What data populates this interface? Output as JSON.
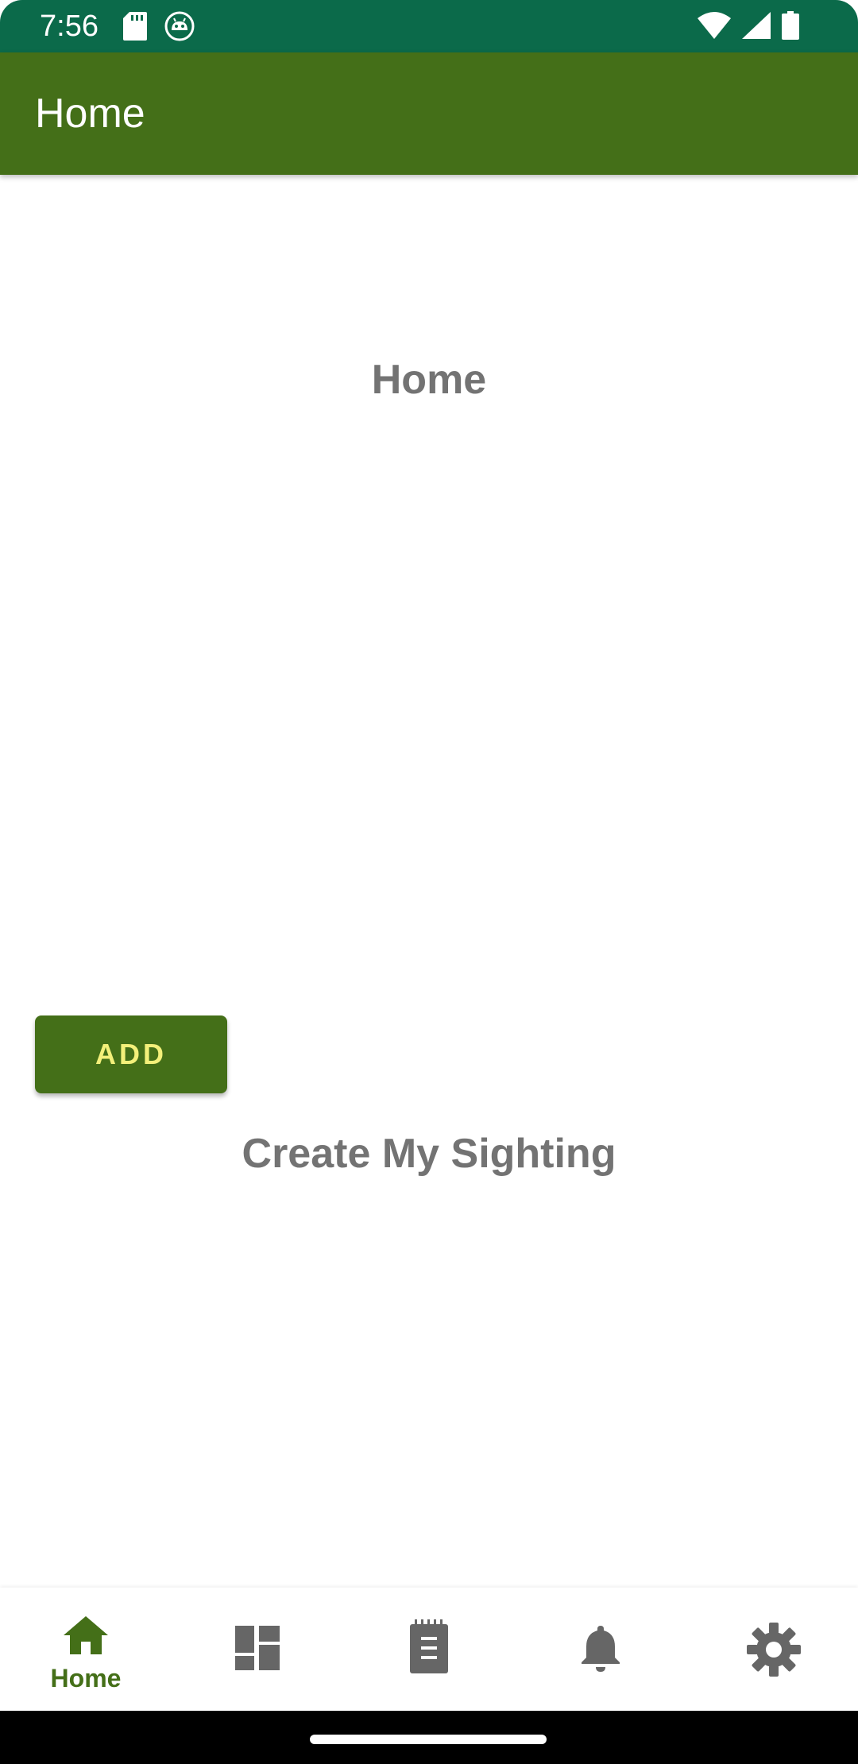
{
  "status_bar": {
    "time": "7:56",
    "left_icons": [
      "sd-card-icon",
      "android-debug-icon"
    ],
    "right_icons": [
      "wifi-icon",
      "cell-signal-icon",
      "battery-icon"
    ],
    "color": "#0b6a4a"
  },
  "app_bar": {
    "title": "Home",
    "color": "#446f18"
  },
  "content": {
    "title": "Home",
    "add_button_label": "ADD",
    "caption": "Create My Sighting"
  },
  "bottom_nav": {
    "items": [
      {
        "icon": "home-icon",
        "label": "Home",
        "active": true
      },
      {
        "icon": "dashboard-icon",
        "label": "",
        "active": false
      },
      {
        "icon": "notepad-icon",
        "label": "",
        "active": false
      },
      {
        "icon": "bell-icon",
        "label": "",
        "active": false
      },
      {
        "icon": "gear-icon",
        "label": "",
        "active": false
      }
    ],
    "active_color": "#446f18",
    "inactive_color": "#666666"
  },
  "colors": {
    "accent": "#446f18",
    "button_text": "#f3f07a",
    "text_gray": "#737373"
  }
}
